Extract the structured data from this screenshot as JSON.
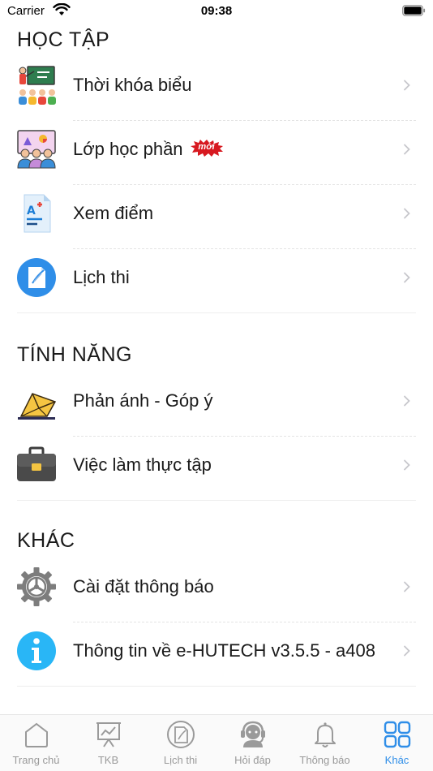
{
  "status_bar": {
    "carrier": "Carrier",
    "time": "09:38"
  },
  "sections": [
    {
      "title": "HỌC TẬP",
      "items": [
        {
          "label": "Thời khóa biểu",
          "icon": "teacher-board-icon"
        },
        {
          "label": "Lớp học phần",
          "icon": "classroom-icon",
          "badge": "mới"
        },
        {
          "label": "Xem điểm",
          "icon": "grade-report-icon"
        },
        {
          "label": "Lịch thi",
          "icon": "exam-note-icon"
        }
      ]
    },
    {
      "title": "TÍNH NĂNG",
      "items": [
        {
          "label": "Phản ánh - Góp ý",
          "icon": "feedback-envelope-icon"
        },
        {
          "label": "Việc làm thực tập",
          "icon": "briefcase-icon"
        }
      ]
    },
    {
      "title": "KHÁC",
      "items": [
        {
          "label": "Cài đặt thông báo",
          "icon": "gear-icon"
        },
        {
          "label": "Thông tin về e-HUTECH v3.5.5 - a408",
          "icon": "info-icon"
        }
      ]
    }
  ],
  "tabbar": {
    "tabs": [
      {
        "label": "Trang chủ",
        "icon": "home-icon"
      },
      {
        "label": "TKB",
        "icon": "presentation-chart-icon"
      },
      {
        "label": "Lịch thi",
        "icon": "exam-icon"
      },
      {
        "label": "Hỏi đáp",
        "icon": "support-headset-icon"
      },
      {
        "label": "Thông báo",
        "icon": "bell-icon"
      },
      {
        "label": "Khác",
        "icon": "grid-icon",
        "active": true
      }
    ],
    "active_color": "#2f8ee8",
    "inactive_color": "#9a9a9a"
  }
}
